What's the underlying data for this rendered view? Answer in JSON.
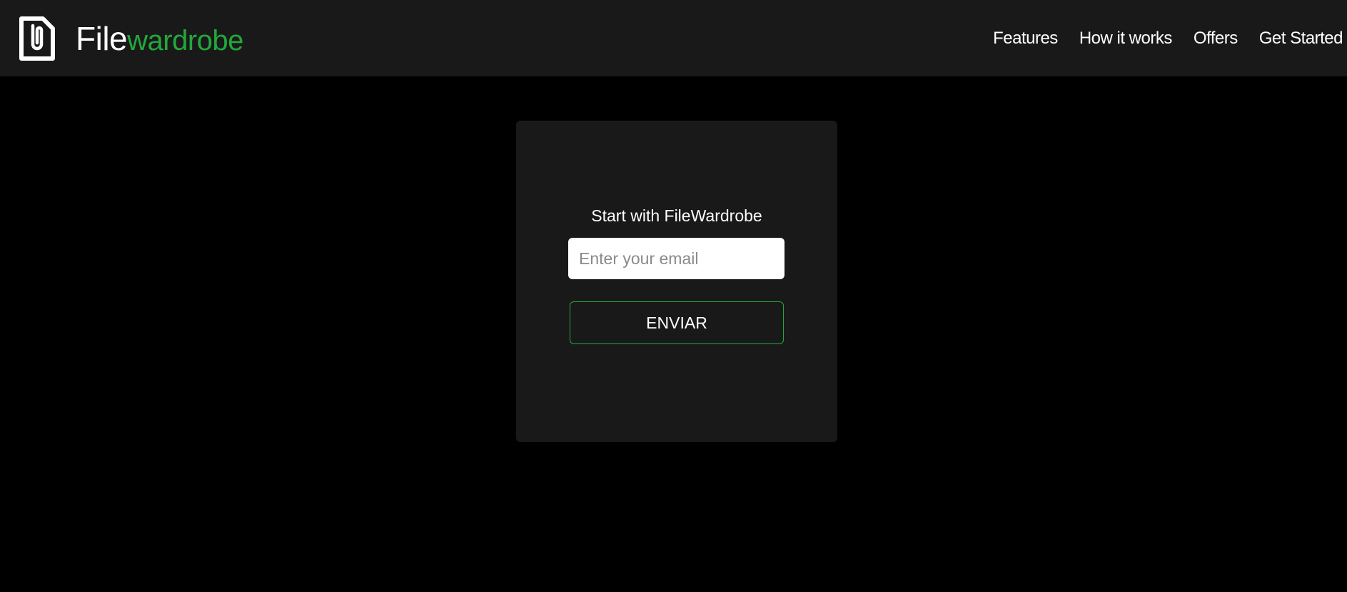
{
  "header": {
    "logo": {
      "icon": "paperclip-file-icon",
      "text_part1": "File",
      "text_part2": "wardrobe"
    },
    "nav": [
      {
        "label": "Features"
      },
      {
        "label": "How it works"
      },
      {
        "label": "Offers"
      },
      {
        "label": "Get Started"
      }
    ]
  },
  "signup": {
    "title": "Start with FileWardrobe",
    "email_placeholder": "Enter your email",
    "email_value": "",
    "submit_label": "ENVIAR"
  },
  "colors": {
    "background": "#000000",
    "surface": "#1a191a",
    "accent": "#22a83a",
    "text": "#ffffff"
  }
}
